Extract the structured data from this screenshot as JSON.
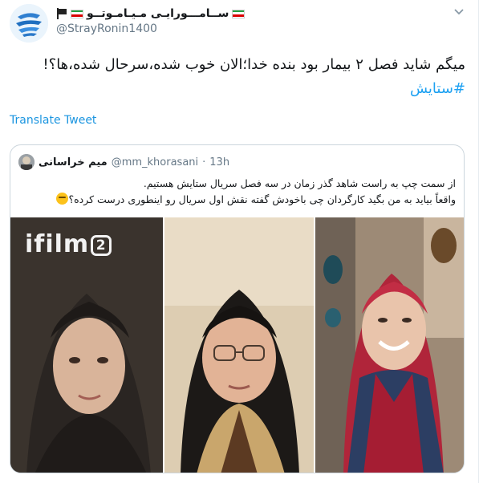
{
  "tweet": {
    "display_name": "ســامـــورایـی مـیـامـوتــو",
    "handle": "@StrayRonin1400",
    "text": "میگم شاید فصل ۲ بیمار بود بنده خدا؛الان خوب شده،سرحال شده،ها؟!",
    "hashtag": "#ستایش",
    "translate_label": "Translate Tweet",
    "caret_icon": "chevron-down-icon"
  },
  "quoted": {
    "name": "میم خراسانی",
    "handle": "@mm_khorasani",
    "separator": "·",
    "time": "13h",
    "line1": "از سمت چپ به راست شاهد گذر زمان در سه فصل سریال ستایش هستیم.",
    "line2": "واقعاً بیاید به من بگید کارگردان چی باخودش گفته نقش اول سریال رو اینطوری درست کرده؟",
    "watermark_logo": "ifilm",
    "watermark_number": "2"
  },
  "colors": {
    "link": "#1da1f2",
    "secondary_text": "#657786",
    "border": "#ccd6dd"
  }
}
